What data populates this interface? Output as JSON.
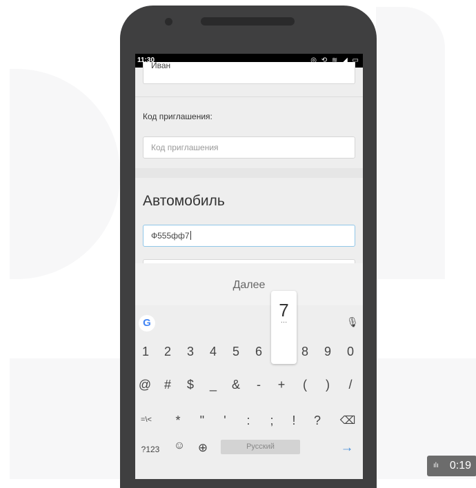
{
  "status": {
    "time": "11:30",
    "icons": "◎ ⟲ ≋ ◢ ▭"
  },
  "form": {
    "name_value": "Иван",
    "invite_label": "Код приглашения:",
    "invite_placeholder": "Код приглашения",
    "section_title": "Автомобиль",
    "car_number_value": "Ф555фф7"
  },
  "keyboard": {
    "action_label": "Далее",
    "google_icon": "G",
    "mic_icon": "🎙",
    "popup_key": "7",
    "popup_dots": "…",
    "row1": [
      "1",
      "2",
      "3",
      "4",
      "5",
      "6",
      "",
      "8",
      "9",
      "0"
    ],
    "row2": [
      "@",
      "#",
      "$",
      "_",
      "&",
      "-",
      "+",
      "(",
      ")",
      "/"
    ],
    "row3": [
      "=\\<",
      "*",
      "\"",
      "'",
      ":",
      ";",
      "!",
      "?",
      "⌫"
    ],
    "mode_label": "?123",
    "emoji_icon": "☺",
    "globe_icon": "⊕",
    "space_label": "Русский",
    "enter_icon": "→"
  },
  "video": {
    "bars_icon": "ılı",
    "time": "0:19"
  }
}
